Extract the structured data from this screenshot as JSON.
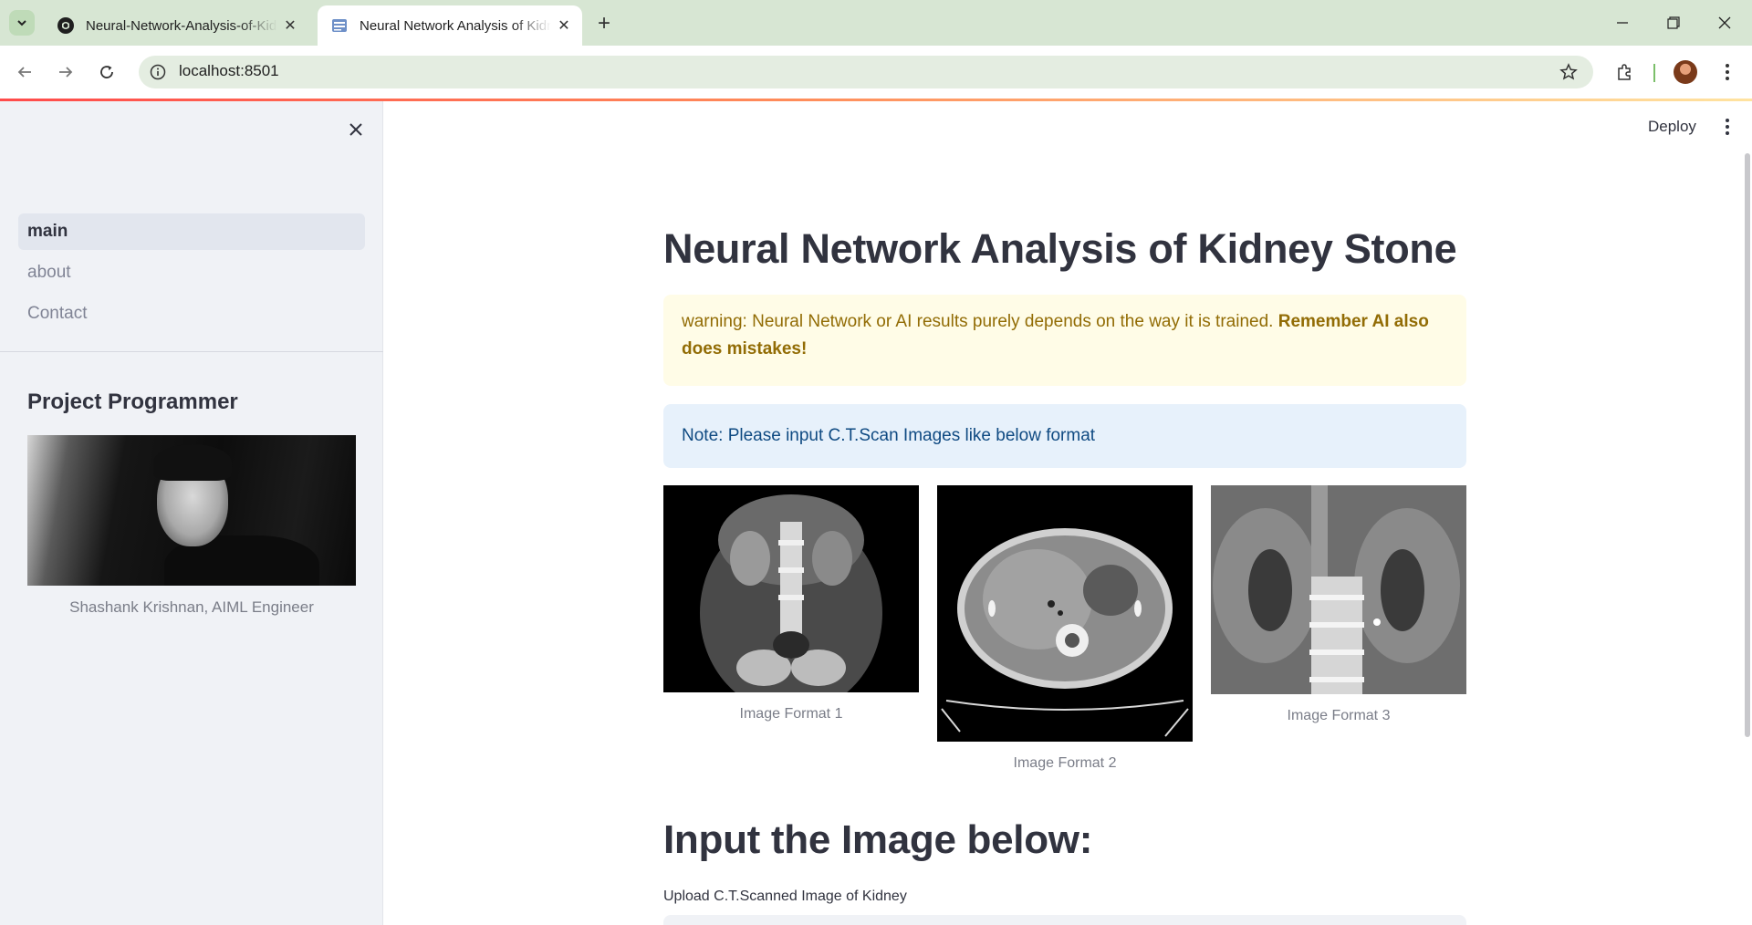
{
  "browser": {
    "tabs": [
      {
        "title": "Neural-Network-Analysis-of-Kidney-Stone",
        "active": false
      },
      {
        "title": "Neural Network Analysis of Kidney Stone",
        "active": true
      }
    ],
    "url": "localhost:8501"
  },
  "app": {
    "deploy_label": "Deploy"
  },
  "sidebar": {
    "nav": [
      {
        "label": "main",
        "active": true
      },
      {
        "label": "about",
        "active": false
      },
      {
        "label": "Contact",
        "active": false
      }
    ],
    "heading": "Project Programmer",
    "caption": "Shashank Krishnan, AIML Engineer"
  },
  "main": {
    "title": "Neural Network Analysis of Kidney Stone",
    "warning": {
      "text": "warning: Neural Network or AI results purely depends on the way it is trained. ",
      "bold": "Remember AI also does mistakes!"
    },
    "info": "Note: Please input C.T.Scan Images like below format",
    "images": [
      {
        "caption": "Image Format 1"
      },
      {
        "caption": "Image Format 2"
      },
      {
        "caption": "Image Format 3"
      }
    ],
    "input_heading": "Input the Image below:",
    "upload_label": "Upload C.T.Scanned Image of Kidney"
  },
  "colors": {
    "tabbar": "#d7e6d3",
    "sidebar_bg": "#f0f2f6",
    "warning_bg": "#fffce7",
    "warning_text": "#926c05",
    "info_bg": "#e7f1fb",
    "info_text": "#0f4a82",
    "accent": "#ff4b4b"
  }
}
